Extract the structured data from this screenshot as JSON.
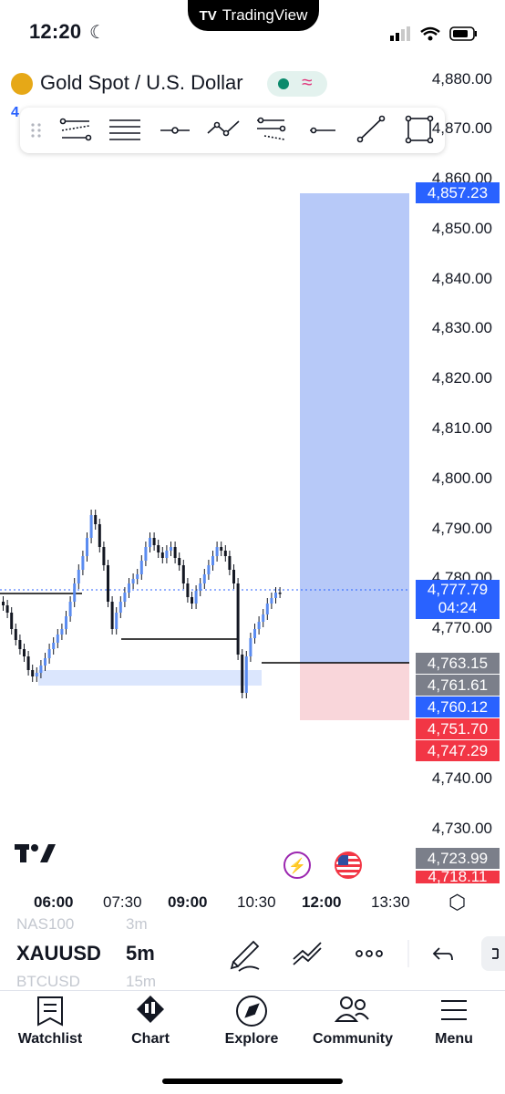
{
  "status_bar": {
    "time": "12:20",
    "app_badge": "TradingView"
  },
  "header": {
    "symbol_title": "Gold Spot / U.S. Dollar",
    "left_digit": "4"
  },
  "price_axis": {
    "labels": [
      "4,880.00",
      "4,870.00",
      "4,860.00",
      "4,850.00",
      "4,840.00",
      "4,830.00",
      "4,820.00",
      "4,810.00",
      "4,800.00",
      "4,790.00",
      "4,780.00",
      "4,770.00",
      "4,740.00",
      "4,730.00"
    ]
  },
  "price_tags": {
    "target": "4,857.23",
    "last_price": "4,777.79",
    "countdown": "04:24",
    "entry_1": "4,763.15",
    "entry_2": "4,761.61",
    "low_blue": "4,760.12",
    "stop_1": "4,751.70",
    "stop_2": "4,747.29",
    "gray_low": "4,723.99",
    "red_low": "4,718.11"
  },
  "colors": {
    "tag_blue": "#2962ff",
    "tag_gray": "#7b7f8a",
    "tag_red": "#f23645",
    "profit_zone": "#b7c9f8",
    "loss_zone": "#f9d6da",
    "candle_blue": "#5b8cf0"
  },
  "time_axis": {
    "labels": [
      "06:00",
      "07:30",
      "09:00",
      "10:30",
      "12:00",
      "13:30"
    ]
  },
  "bottom_bar": {
    "symbol_prev": "NAS100",
    "interval_prev": "3m",
    "symbol": "XAUUSD",
    "interval": "5m",
    "symbol_next": "BTCUSD",
    "interval_next": "15m"
  },
  "tabs": {
    "watchlist": "Watchlist",
    "chart": "Chart",
    "explore": "Explore",
    "community": "Community",
    "menu": "Menu"
  }
}
